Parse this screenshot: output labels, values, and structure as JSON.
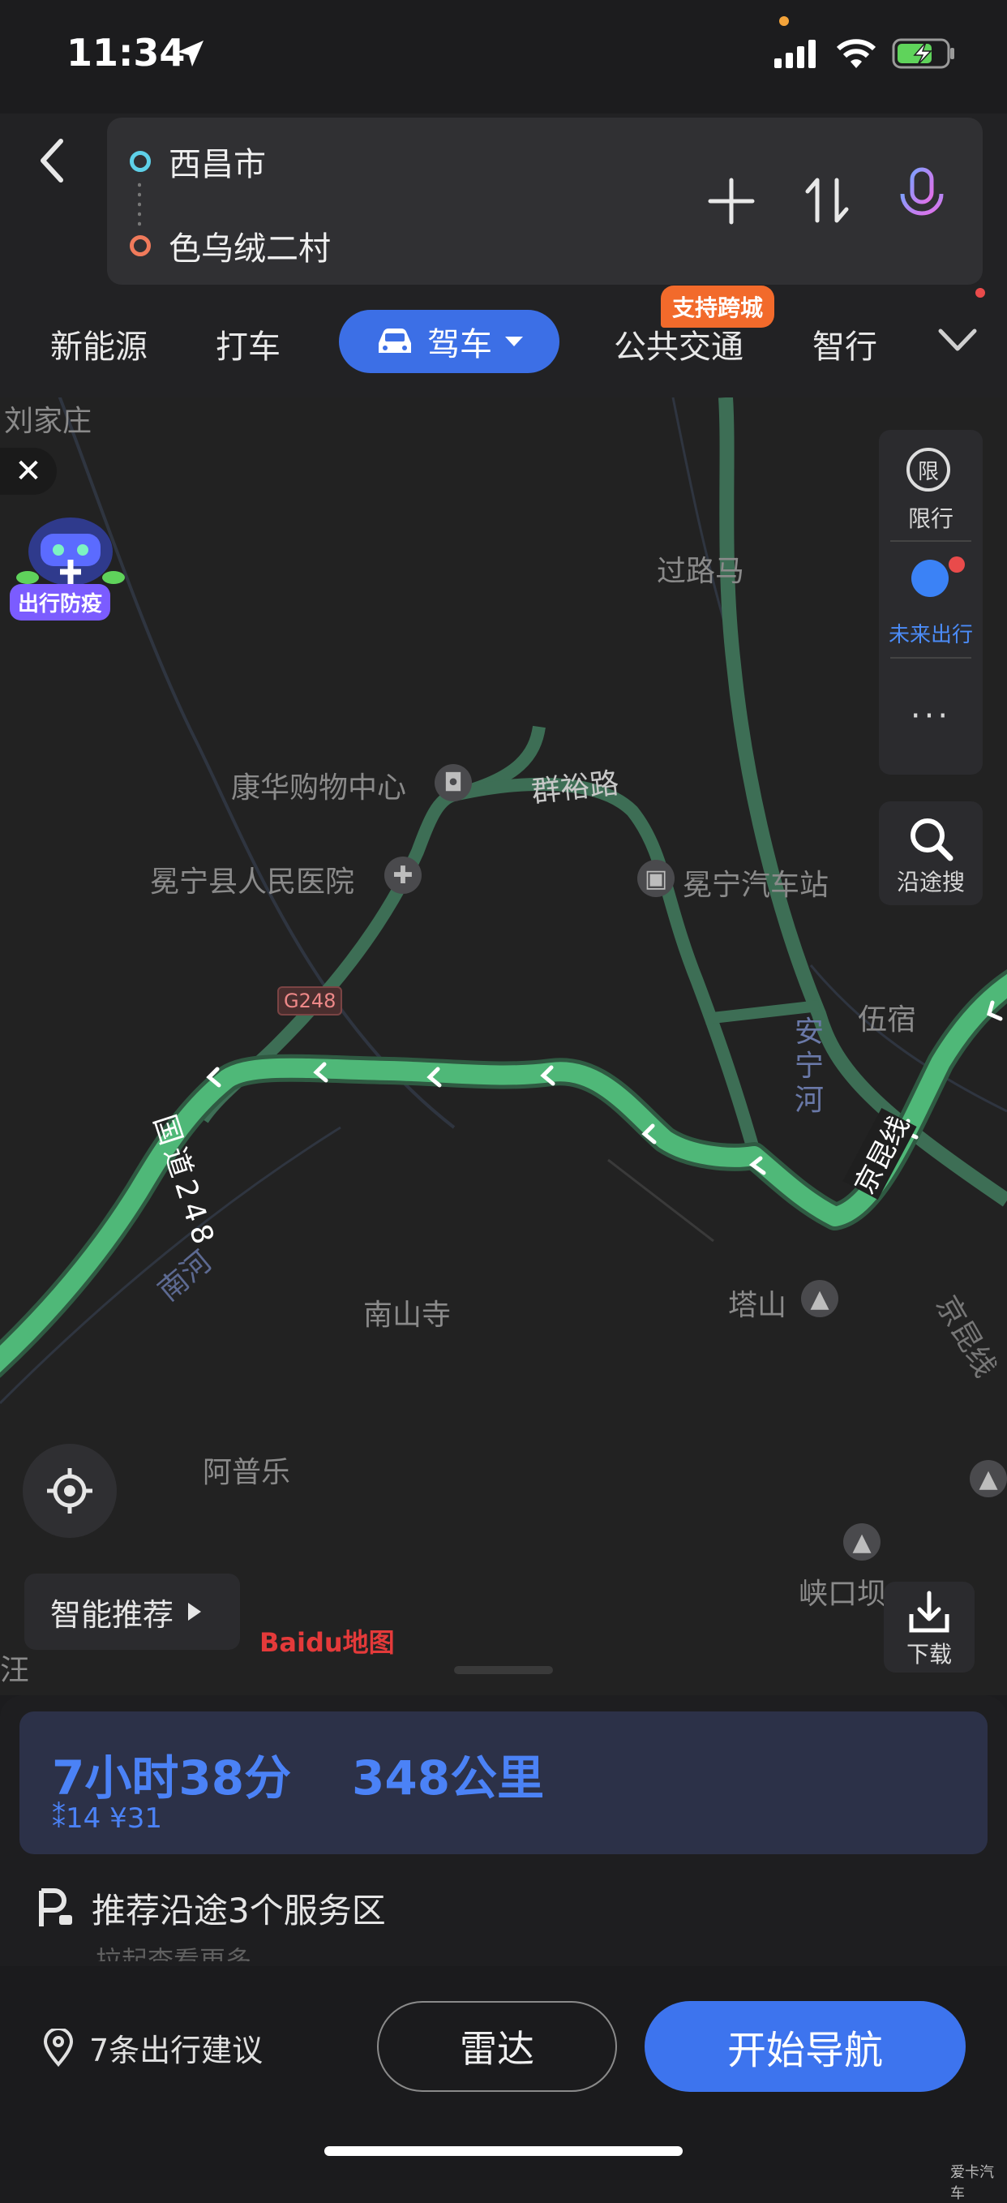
{
  "status": {
    "time": "11:34"
  },
  "route": {
    "origin": "西昌市",
    "destination": "色乌绒二村"
  },
  "tabs": [
    {
      "label": "新能源"
    },
    {
      "label": "打车"
    },
    {
      "label": "驾车"
    },
    {
      "label": "公共交通"
    },
    {
      "label": "智行"
    }
  ],
  "badge": {
    "cross_city": "支持跨城"
  },
  "map": {
    "labels": {
      "liujiazhuang": "刘家庄",
      "guoluma": "过路马",
      "kanghua": "康华购物中心",
      "qunyu": "群裕路",
      "hospital": "冕宁县人民医院",
      "bus_station": "冕宁汽车站",
      "g248": "G248",
      "wusu": "伍宿",
      "anning": "安宁河",
      "jingkun": "京昆线",
      "jingkun2": "京昆线",
      "guodao": "国道248",
      "nanhe": "南河",
      "nanshansi": "南山寺",
      "tashan": "塔山",
      "apule": "阿普乐",
      "xiakou": "峡口坝",
      "wang": "汪",
      "epidemic": "出行防疫"
    },
    "tools": {
      "restriction": "限行",
      "restriction_icon": "限",
      "future": "未来出行",
      "search_along": "沿途搜",
      "download": "下载",
      "smart": "智能推荐",
      "baidu": "Baidu地图"
    }
  },
  "summary": {
    "time": "7小时38分",
    "distance": "348公里",
    "traffic_lights": "14",
    "cost": "¥31",
    "service": "推荐沿途3个服务区",
    "more": "拉起查看更多"
  },
  "bottom": {
    "suggestions": "7条出行建议",
    "radar": "雷达",
    "navigate": "开始导航"
  },
  "watermark": "爱卡汽车"
}
